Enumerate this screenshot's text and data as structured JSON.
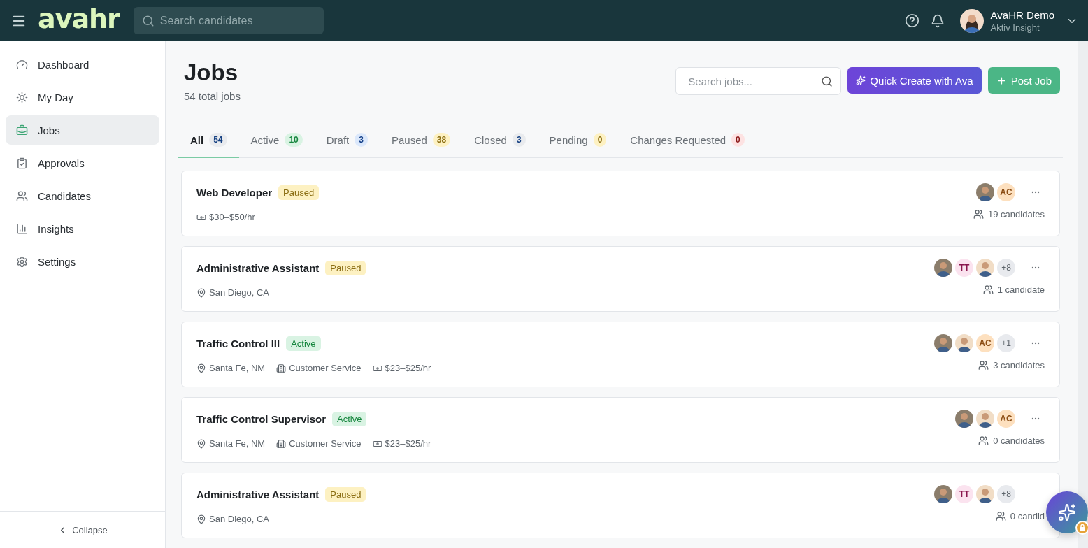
{
  "header": {
    "logo": "avahr",
    "search": {
      "placeholder": "Search candidates"
    },
    "user": {
      "name": "AvaHR Demo",
      "org": "Aktiv Insight"
    }
  },
  "sidebar": {
    "items": [
      {
        "label": "Dashboard",
        "selected": false
      },
      {
        "label": "My Day",
        "selected": false
      },
      {
        "label": "Jobs",
        "selected": true
      },
      {
        "label": "Approvals",
        "selected": false
      },
      {
        "label": "Candidates",
        "selected": false
      },
      {
        "label": "Insights",
        "selected": false
      },
      {
        "label": "Settings",
        "selected": false
      }
    ],
    "collapse": "Collapse"
  },
  "page": {
    "title": "Jobs",
    "subtitle": "54 total jobs",
    "search": {
      "placeholder": "Search jobs..."
    },
    "buttons": [
      {
        "kind": "ai",
        "label": "Quick Create with Ava"
      },
      {
        "kind": "add",
        "label": "Post Job"
      }
    ]
  },
  "tabs": [
    {
      "label": "All",
      "count": "54",
      "color": "#e9ebee",
      "selected": true
    },
    {
      "label": "Active",
      "count": "10",
      "color": "#d9f3e3",
      "selected": false
    },
    {
      "label": "Draft",
      "count": "3",
      "color": "#dbe8fb",
      "selected": false
    },
    {
      "label": "Paused",
      "count": "38",
      "color": "#fdf1c2",
      "selected": false
    },
    {
      "label": "Closed",
      "count": "3",
      "color": "#e9ebee",
      "selected": false
    },
    {
      "label": "Pending",
      "count": "0",
      "color": "#fdf1c2",
      "selected": false
    },
    {
      "label": "Changes Requested",
      "count": "0",
      "color": "#fde2e2",
      "selected": false
    }
  ],
  "jobs": [
    {
      "title": "Web Developer",
      "status": {
        "label": "Paused",
        "color": "#fdf1c2"
      },
      "meta": [
        {
          "kind": "pay",
          "text": "$30–$50/hr"
        }
      ],
      "avatars": [
        {
          "kind": "photo",
          "color": "#8b7d6b"
        },
        {
          "kind": "initials",
          "text": "AC",
          "color": "#fde0bf"
        }
      ],
      "menu": true,
      "candidates": "19 candidates"
    },
    {
      "title": "Administrative Assistant",
      "status": {
        "label": "Paused",
        "color": "#fdf1c2"
      },
      "meta": [
        {
          "kind": "location",
          "text": "San Diego, CA"
        }
      ],
      "avatars": [
        {
          "kind": "photo",
          "color": "#8b7d6b"
        },
        {
          "kind": "initials",
          "text": "TT",
          "color": "#fbe3ef"
        },
        {
          "kind": "photo",
          "color": "#f1ddc6"
        },
        {
          "kind": "more",
          "text": "+8"
        }
      ],
      "menu": true,
      "candidates": "1 candidate"
    },
    {
      "title": "Traffic Control III",
      "status": {
        "label": "Active",
        "color": "#d9f3e3"
      },
      "meta": [
        {
          "kind": "location",
          "text": "Santa Fe, NM"
        },
        {
          "kind": "department",
          "text": "Customer Service"
        },
        {
          "kind": "pay",
          "text": "$23–$25/hr"
        }
      ],
      "avatars": [
        {
          "kind": "photo",
          "color": "#8b7d6b"
        },
        {
          "kind": "photo",
          "color": "#f1ddc6"
        },
        {
          "kind": "initials",
          "text": "AC",
          "color": "#fde0bf"
        },
        {
          "kind": "more",
          "text": "+1"
        }
      ],
      "menu": true,
      "candidates": "3 candidates"
    },
    {
      "title": "Traffic Control Supervisor",
      "status": {
        "label": "Active",
        "color": "#d9f3e3"
      },
      "meta": [
        {
          "kind": "location",
          "text": "Santa Fe, NM"
        },
        {
          "kind": "department",
          "text": "Customer Service"
        },
        {
          "kind": "pay",
          "text": "$23–$25/hr"
        }
      ],
      "avatars": [
        {
          "kind": "photo",
          "color": "#8b7d6b"
        },
        {
          "kind": "photo",
          "color": "#f1ddc6"
        },
        {
          "kind": "initials",
          "text": "AC",
          "color": "#fde0bf"
        }
      ],
      "menu": true,
      "candidates": "0 candidates"
    },
    {
      "title": "Administrative Assistant",
      "status": {
        "label": "Paused",
        "color": "#fdf1c2"
      },
      "meta": [
        {
          "kind": "location",
          "text": "San Diego, CA"
        }
      ],
      "avatars": [
        {
          "kind": "photo",
          "color": "#8b7d6b"
        },
        {
          "kind": "initials",
          "text": "TT",
          "color": "#fbe3ef"
        },
        {
          "kind": "photo",
          "color": "#f1ddc6"
        },
        {
          "kind": "more",
          "text": "+8"
        }
      ],
      "menu": false,
      "candidates": "0 candid"
    }
  ]
}
